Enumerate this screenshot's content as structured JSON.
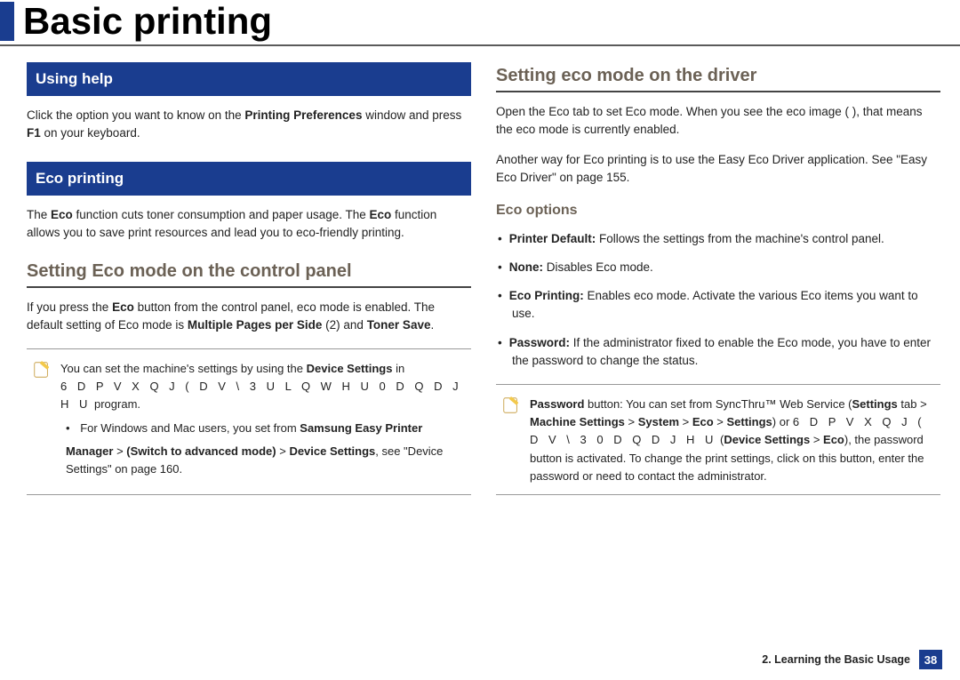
{
  "page_title": "Basic printing",
  "left": {
    "using_help": {
      "title": "Using help",
      "para_a": "Click the option you want to know on the ",
      "para_b": "Printing Preferences",
      "para_c": " window and press ",
      "para_d": "F1",
      "para_e": " on your keyboard."
    },
    "eco_printing": {
      "title": "Eco printing",
      "para_a": "The ",
      "para_b": "Eco",
      "para_c": " function cuts toner consumption and paper usage. The ",
      "para_d": "Eco",
      "para_e": " function allows you to save print resources and lead you to eco-friendly printing."
    },
    "control_panel": {
      "heading": "Setting Eco mode on the control panel",
      "para_a": "If you press the ",
      "para_b": "Eco",
      "para_c": " button from the control panel, eco mode is enabled. The default setting of Eco mode is ",
      "para_d": "Multiple Pages per Side",
      "para_e": " (2) and ",
      "para_f": "Toner Save",
      "para_g": "."
    },
    "note": {
      "line1_a": "You can set the machine's settings by using the ",
      "line1_b": "Device Settings",
      "line1_c": " in",
      "garbled1": "6 D P V X Q J   ( D V \\   3 U L Q W H U   0 D Q D J H U",
      "garbled1_plain": " program.",
      "bullet_a": "For Windows and Mac users, you set from ",
      "bullet_b": "Samsung Easy Printer",
      "bullet_c": "Manager",
      "bullet_d": " > ",
      "bullet_e": "(Switch to advanced mode)",
      "bullet_f": " > ",
      "bullet_g": "Device Settings",
      "bullet_h": ", see \"Device Settings\" on page 160."
    }
  },
  "right": {
    "driver": {
      "heading": "Setting eco mode on the driver",
      "para1": "Open the Eco tab to set Eco mode. When you see the eco image (        ), that means the eco mode is currently enabled.",
      "para2": "Another way for Eco printing is to use the Easy Eco Driver application. See \"Easy Eco Driver\" on page 155."
    },
    "eco_options": {
      "heading": "Eco options",
      "opt1_b": "Printer Default:",
      "opt1_t": " Follows the settings from the machine's control panel.",
      "opt2_b": "None:",
      "opt2_t": " Disables Eco mode.",
      "opt3_b": "Eco Printing:",
      "opt3_t": " Enables eco mode. Activate the various Eco items you want to use.",
      "opt4_b": "Password:",
      "opt4_t": " If the administrator fixed to enable the Eco mode, you have to enter the password to change the status."
    },
    "note": {
      "a": "Password",
      "b": " button: You can set from SyncThru™ Web Service (",
      "c": "Settings",
      "d": " tab > ",
      "e": "Machine Settings",
      "f": " > ",
      "g": "System",
      "h": " > ",
      "i": "Eco",
      "j": " > ",
      "k": "Settings",
      "l": ") or ",
      "garbled": "6 D P V X Q J   ( D V \\   3   0 D Q D J H U",
      "m": " (",
      "n": "Device Settings",
      "o": " > ",
      "p": "Eco",
      "q": "), the password button is activated. To change the print settings, click on this button, enter the password or need to contact the administrator."
    }
  },
  "footer": {
    "section": "2. Learning the Basic Usage",
    "page": "38"
  }
}
